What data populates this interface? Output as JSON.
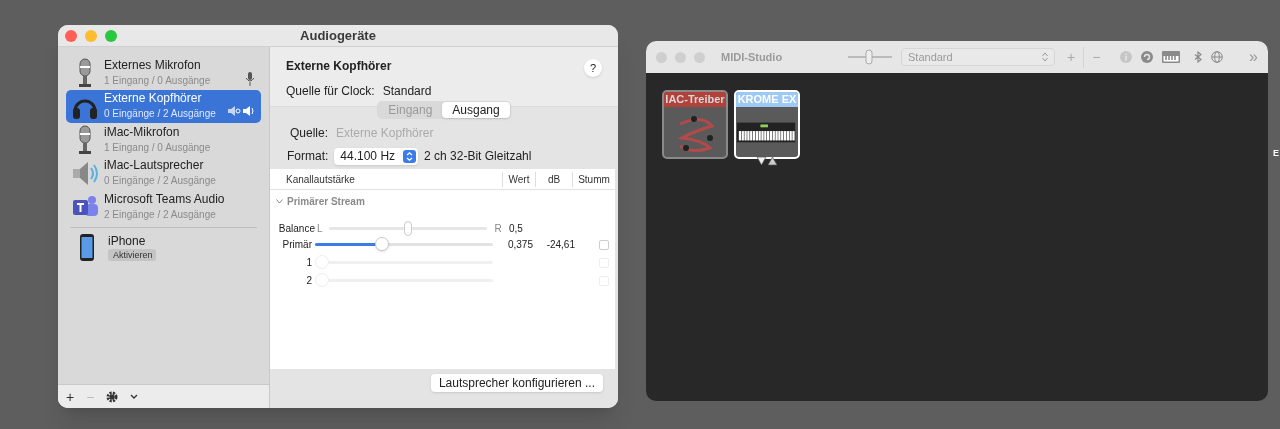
{
  "audio_window": {
    "title": "Audiogeräte",
    "devices": [
      {
        "kind": "microphone",
        "name": "Externes Mikrofon",
        "io": "1 Eingang / 0 Ausgänge",
        "selected": false,
        "default_input": true,
        "default_output": false
      },
      {
        "kind": "headphones",
        "name": "Externe Kopfhörer",
        "io": "0 Eingänge / 2 Ausgänge",
        "selected": true,
        "default_input": false,
        "default_output": true
      },
      {
        "kind": "microphone",
        "name": "iMac-Mikrofon",
        "io": "1 Eingang / 0 Ausgänge",
        "selected": false,
        "default_input": false,
        "default_output": false
      },
      {
        "kind": "speaker",
        "name": "iMac-Lautsprecher",
        "io": "0 Eingänge / 2 Ausgänge",
        "selected": false,
        "default_input": false,
        "default_output": false
      },
      {
        "kind": "teams",
        "name": "Microsoft Teams Audio",
        "io": "2 Eingänge / 2 Ausgänge",
        "selected": false,
        "default_input": false,
        "default_output": false
      }
    ],
    "phone": {
      "name": "iPhone",
      "button": "Aktivieren"
    },
    "sidebar_buttons": [
      "+",
      "−"
    ],
    "detail": {
      "title": "Externe Kopfhörer",
      "help": "?",
      "clock_label": "Quelle für Clock:",
      "clock_value": "Standard",
      "tabs": [
        {
          "label": "Eingang",
          "selected": false
        },
        {
          "label": "Ausgang",
          "selected": true
        }
      ],
      "source_label": "Quelle:",
      "source_value": "Externe Kopfhörer",
      "format_label": "Format:",
      "format_value": "44.100 Hz",
      "format_info": "2 ch 32-Bit Gleitzahl",
      "table": {
        "columns": [
          "Kanallautstärke",
          "Wert",
          "dB",
          "Stumm"
        ],
        "group": "Primärer Stream",
        "expanded": true,
        "balance": {
          "label": "Balance",
          "left": "L",
          "right": "R",
          "level": 0.5,
          "value": "0,5"
        },
        "channels": [
          {
            "label": "Primär",
            "level": 0.375,
            "value": "0,375",
            "db": "-24,61",
            "muted": false,
            "disabled": false
          },
          {
            "label": "1",
            "level": 0,
            "muted": false,
            "disabled": true
          },
          {
            "label": "2",
            "level": 0,
            "muted": false,
            "disabled": true
          }
        ]
      },
      "configure_button": "Lautsprecher konfigurieren ..."
    }
  },
  "midi_window": {
    "title": "MIDI-Studio",
    "toolbar_popup": "Standard",
    "toolbar_buttons": [
      "+",
      "−"
    ],
    "overflow": "»",
    "devices": [
      {
        "kind": "driver",
        "name": "IAC-Treiber",
        "color": "#b0413b",
        "selected": false
      },
      {
        "kind": "keyboard",
        "name": "KROME EX",
        "color": "#9ec9f5",
        "selected": true
      }
    ]
  },
  "edge_text": "E"
}
